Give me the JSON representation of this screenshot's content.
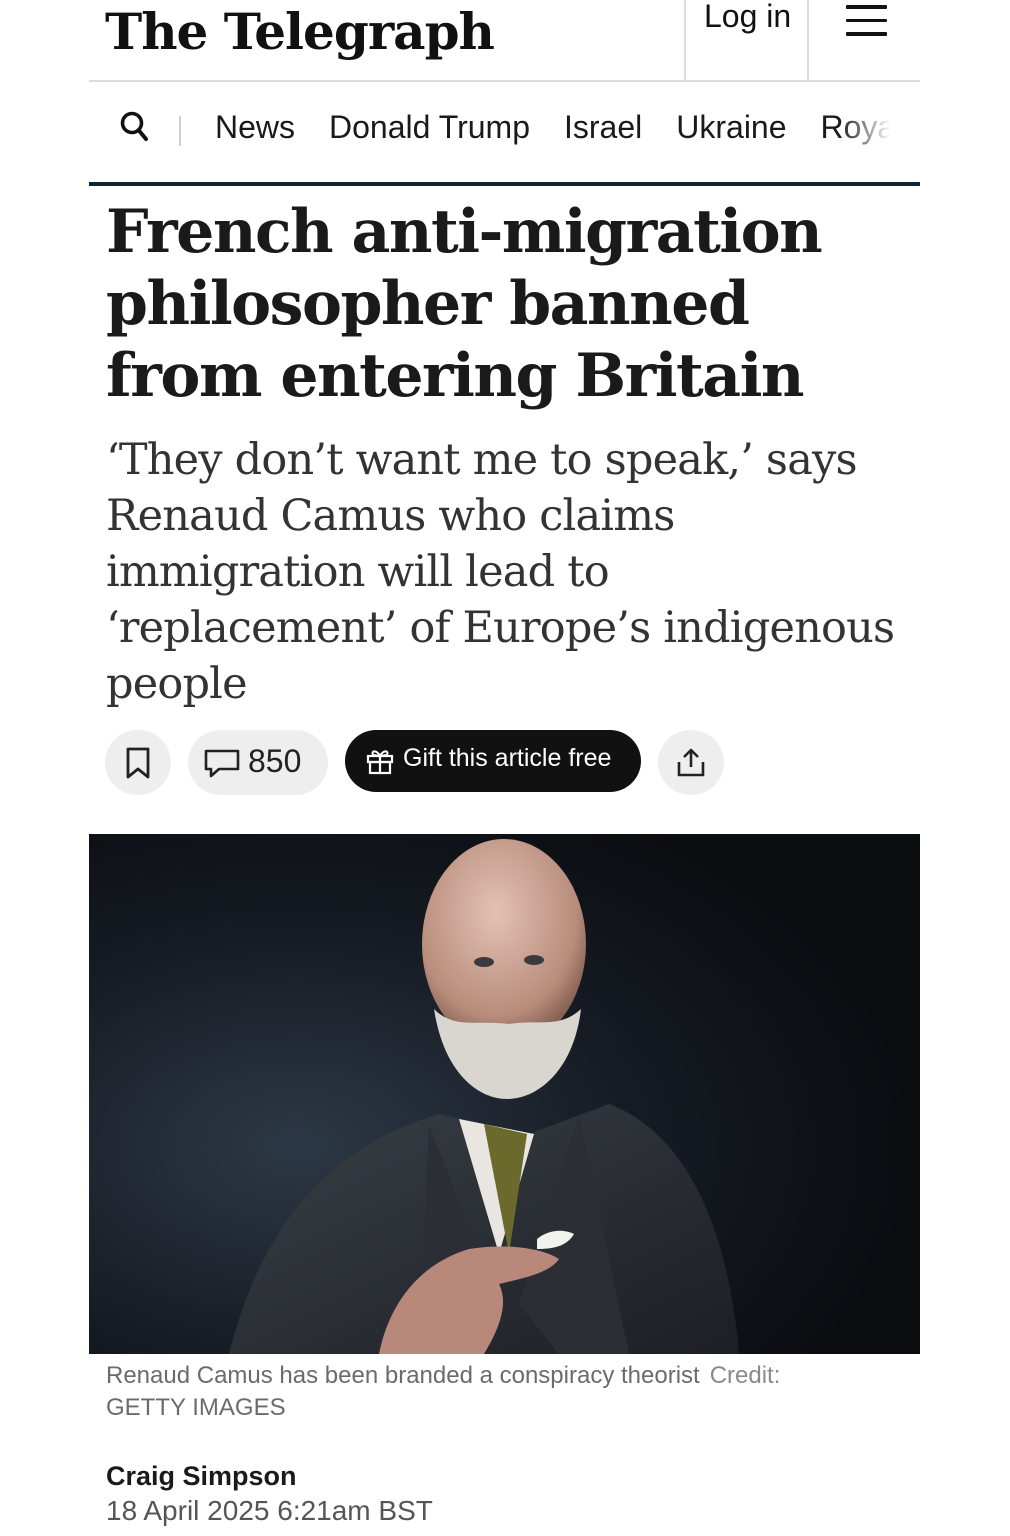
{
  "header": {
    "logo_text": "The Telegraph",
    "login_label": "Log in",
    "menu_icon": "hamburger-menu-icon"
  },
  "nav": {
    "search_icon": "search-icon",
    "items": [
      "News",
      "Donald Trump",
      "Israel",
      "Ukraine",
      "Royals"
    ]
  },
  "article": {
    "headline": "French anti-migration philosopher banned from entering Britain",
    "standfirst": "‘They don’t want me to speak,’ says Renaud Camus who claims immigration will lead to ‘replacement’ of Europe’s indigenous people",
    "actions": {
      "bookmark_icon": "bookmark-icon",
      "comment_icon": "comment-icon",
      "comment_count": "850",
      "gift_icon": "gift-icon",
      "gift_label": "Gift this article free",
      "share_icon": "share-icon"
    },
    "image": {
      "caption": "Renaud Camus has been branded a conspiracy theorist",
      "credit_label": "Credit:",
      "credit": "GETTY IMAGES"
    },
    "author": "Craig Simpson",
    "published": "18 April 2025 6:21am BST"
  },
  "colors": {
    "nav_rule": "#0f2535",
    "gift_button_bg": "#111111",
    "pill_bg": "#eeeeee"
  }
}
